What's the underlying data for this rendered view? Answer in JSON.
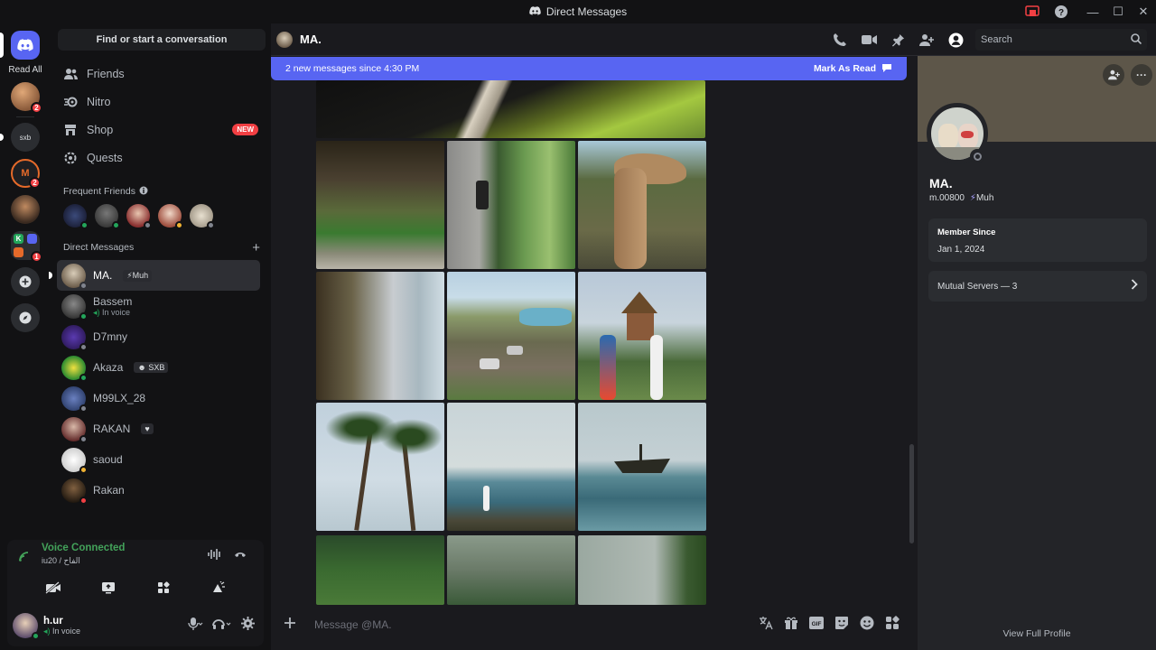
{
  "window": {
    "title": "Direct Messages"
  },
  "guilds": {
    "read_all": "Read All",
    "badges": [
      "2",
      "2",
      "1"
    ]
  },
  "sidebar": {
    "search_label": "Find or start a conversation",
    "nav": [
      {
        "label": "Friends"
      },
      {
        "label": "Nitro"
      },
      {
        "label": "Shop",
        "badge": "NEW"
      },
      {
        "label": "Quests"
      }
    ],
    "frequent_friends_label": "Frequent Friends",
    "direct_messages_label": "Direct Messages",
    "dms": [
      {
        "name": "MA.",
        "tag": "Muh"
      },
      {
        "name": "Bassem",
        "sub": "In voice"
      },
      {
        "name": "D7mny"
      },
      {
        "name": "Akaza",
        "tag": "SXB"
      },
      {
        "name": "M99LX_28"
      },
      {
        "name": "RAKAN"
      },
      {
        "name": "saoud"
      },
      {
        "name": "Rakan"
      }
    ]
  },
  "voice": {
    "title": "Voice Connected",
    "channel": "iu20 / الفاح"
  },
  "user": {
    "name": "h.ur",
    "status": "In voice"
  },
  "header": {
    "name": "MA.",
    "search_placeholder": "Search"
  },
  "chat": {
    "new_messages": "2 new messages since 4:30 PM",
    "mark_as_read": "Mark As Read",
    "composer_placeholder": "Message @MA."
  },
  "profile": {
    "name": "MA.",
    "username": "m.00800",
    "tag": "Muh",
    "member_since_label": "Member Since",
    "member_since": "Jan 1, 2024",
    "mutual_servers": "Mutual Servers — 3",
    "view_full": "View Full Profile"
  },
  "colors": {
    "blurple": "#5865f2",
    "green": "#23a55a",
    "red": "#f23f43"
  }
}
